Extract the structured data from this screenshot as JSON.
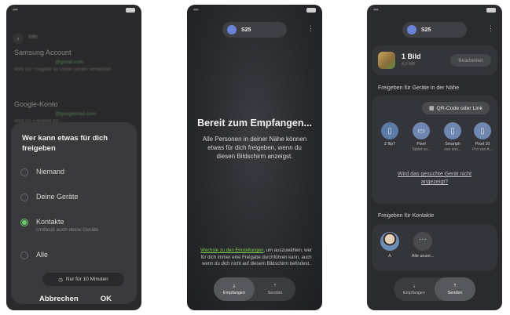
{
  "phone1": {
    "background": {
      "header": "Info",
      "accounts": [
        {
          "name": "Samsung Account",
          "email": "@gmail.com",
          "desc": "Wird zur Freigabe für Deine Geräte verwendet"
        },
        {
          "name": "Google-Konto",
          "email": "@googlemail.com",
          "desc": "Wird zur Freigabe für ..."
        }
      ]
    },
    "dialog": {
      "title": "Wer kann etwas für dich freigeben",
      "options": [
        {
          "label": "Niemand",
          "sub": ""
        },
        {
          "label": "Deine Geräte",
          "sub": ""
        },
        {
          "label": "Kontakte",
          "sub": "Umfasst auch deine Geräte"
        },
        {
          "label": "Alle",
          "sub": ""
        }
      ],
      "selected": "Kontakte",
      "time_limit": "Nur für 10 Minuten",
      "cancel": "Abbrechen",
      "ok": "OK"
    }
  },
  "phone2": {
    "device_chip": "S25",
    "title": "Bereit zum Empfangen...",
    "body": "Alle Personen in deiner Nähe können etwas für dich freigeben, wenn du diesen Bildschirm anzeigst.",
    "footer_link": "Wechsle zu den Einstellungen",
    "footer_text": ", um auszuwählen, wer für dich immer eine Freigabe durchführen kann, auch wenn du dich nicht auf diesem Bildschirm befindest.",
    "nav": {
      "receive": "Empfangen",
      "send": "Senden"
    }
  },
  "phone3": {
    "device_chip": "S25",
    "item": {
      "title": "1 Bild",
      "size": "4,2 MB",
      "edit": "Bearbeiten"
    },
    "nearby": {
      "title": "Freigeben für Geräte in der Nähe",
      "qr": "QR-Code oder Link",
      "devices": [
        {
          "name": "Z flip7",
          "sub": ""
        },
        {
          "name": "Pixel",
          "sub": "Tablet vo..."
        },
        {
          "name": "Smartph",
          "sub": "one von..."
        },
        {
          "name": "Pixel 10",
          "sub": "Pro von A..."
        }
      ],
      "missing": "Wird das gesuchte Gerät nicht angezeigt?"
    },
    "contacts": {
      "title": "Freigeben für Kontakte",
      "items": [
        {
          "name": "A"
        },
        {
          "name": "Alle anzei..."
        }
      ]
    },
    "nav": {
      "receive": "Empfangen",
      "send": "Senden"
    }
  },
  "colors": {
    "accent_green": "#69c96a",
    "link_green": "#7fcc4a",
    "chip_blue": "#6a85d8"
  },
  "icons": [
    "back-arrow-icon",
    "clock-icon",
    "more-vert-icon",
    "download-icon",
    "upload-icon",
    "qr-code-icon",
    "phone-icon",
    "tablet-icon"
  ]
}
